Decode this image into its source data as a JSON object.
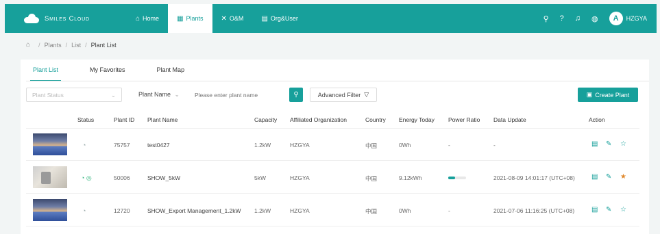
{
  "app": {
    "brand": "Smiles Cloud"
  },
  "nav": {
    "items": [
      {
        "label": "Home",
        "icon": "home-icon"
      },
      {
        "label": "Plants",
        "icon": "plants-icon",
        "active": true
      },
      {
        "label": "O&M",
        "icon": "tools-icon"
      },
      {
        "label": "Org&User",
        "icon": "org-icon"
      }
    ],
    "user": {
      "avatar": "A",
      "name": "HZGYA"
    }
  },
  "breadcrumb": [
    "Plants",
    "List",
    "Plant List"
  ],
  "tabs": [
    "Plant List",
    "My Favorites",
    "Plant Map"
  ],
  "filters": {
    "status_placeholder": "Plant Status",
    "name_select": "Plant Name",
    "search_placeholder": "Please enter plant name",
    "advanced": "Advanced Filter",
    "create": "Create Plant"
  },
  "table": {
    "headers": [
      "Status",
      "Plant ID",
      "Plant Name",
      "Capacity",
      "Affiliated Organization",
      "Country",
      "Energy Today",
      "Power Ratio",
      "Data Update",
      "Action"
    ],
    "rows": [
      {
        "plant_id": "75757",
        "name": "test0427",
        "capacity": "1.2kW",
        "org": "HZGYA",
        "country": "中国",
        "energy": "0Wh",
        "power_ratio": "-",
        "ratio_value": null,
        "data_update": "-",
        "favorite": false,
        "thumb": "sky",
        "online": false
      },
      {
        "plant_id": "50006",
        "name": "SHOW_5kW",
        "capacity": "5kW",
        "org": "HZGYA",
        "country": "中国",
        "energy": "9.12kWh",
        "power_ratio": null,
        "ratio_value": 0.38,
        "data_update": "2021-08-09 14:01:17 (UTC+08)",
        "favorite": true,
        "thumb": "wall",
        "online": true
      },
      {
        "plant_id": "12720",
        "name": "SHOW_Export Management_1.2kW",
        "capacity": "1.2kW",
        "org": "HZGYA",
        "country": "中国",
        "energy": "0Wh",
        "power_ratio": "-",
        "ratio_value": null,
        "data_update": "2021-07-06 11:16:25 (UTC+08)",
        "favorite": false,
        "thumb": "sky",
        "online": false
      }
    ]
  },
  "colors": {
    "accent": "#17a09b",
    "favorite": "#e0882c"
  }
}
